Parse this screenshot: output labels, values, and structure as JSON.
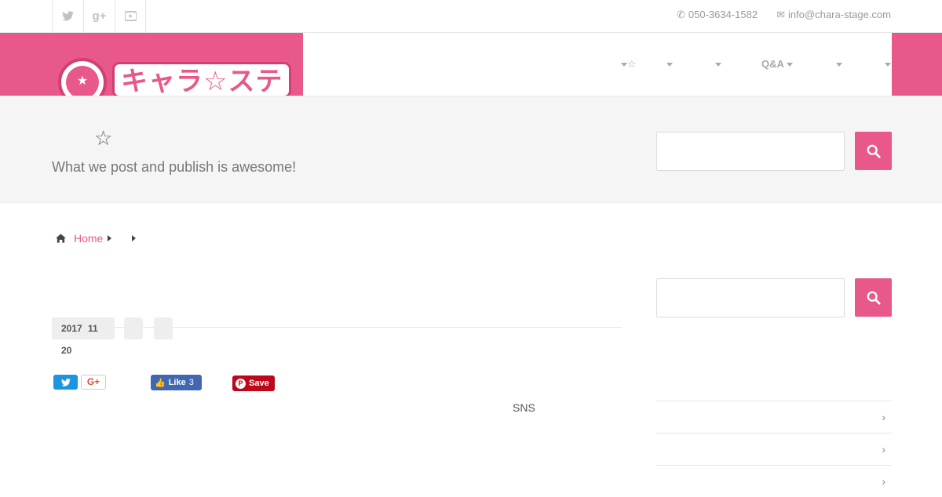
{
  "topbar": {
    "social_icons": [
      "twitter-icon",
      "google-plus-icon",
      "youtube-icon"
    ],
    "phone": "050-3634-1582",
    "email": "info@chara-stage.com"
  },
  "header": {
    "logo_text": "キャラ☆ステ",
    "brand_color": "#e8588a",
    "nav": [
      {
        "label": "☆"
      },
      {
        "label": ""
      },
      {
        "label": ""
      },
      {
        "label": "Q&A"
      },
      {
        "label": ""
      },
      {
        "label": ""
      }
    ]
  },
  "hero": {
    "title": "☆",
    "tagline": "What we post and publish is awesome!"
  },
  "breadcrumb": {
    "home": "Home"
  },
  "post": {
    "date_year": "2017",
    "date_month": "11",
    "date_day": "20",
    "share": {
      "gplus": "G+",
      "fb_like": "Like",
      "fb_count": "3",
      "pin_save": "Save"
    },
    "sns_text": "SNS"
  }
}
